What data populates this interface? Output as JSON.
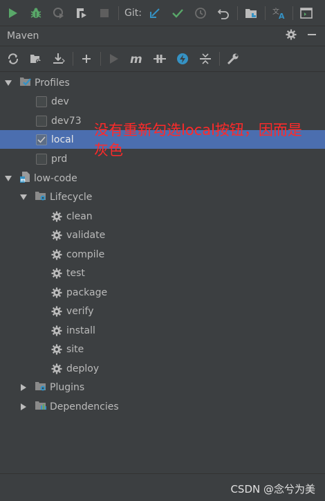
{
  "top_toolbar": {
    "git_label": "Git:"
  },
  "panel": {
    "title": "Maven"
  },
  "tree": {
    "profiles": {
      "label": "Profiles",
      "items": [
        {
          "label": "dev",
          "checked": false
        },
        {
          "label": "dev73",
          "checked": false
        },
        {
          "label": "local",
          "checked": true,
          "selected": true
        },
        {
          "label": "prd",
          "checked": false
        }
      ]
    },
    "project": {
      "label": "low-code",
      "lifecycle": {
        "label": "Lifecycle",
        "items": [
          "clean",
          "validate",
          "compile",
          "test",
          "package",
          "verify",
          "install",
          "site",
          "deploy"
        ]
      },
      "plugins": "Plugins",
      "dependencies": "Dependencies"
    }
  },
  "annotation": "没有重新勾选local按钮，因而是灰色",
  "watermark": "CSDN @念兮为美",
  "colors": {
    "background": "#3c3f41",
    "selection": "#4b6eaf",
    "annotation": "#ff2a2a",
    "run_green": "#59a869",
    "git_blue": "#3592c4"
  }
}
